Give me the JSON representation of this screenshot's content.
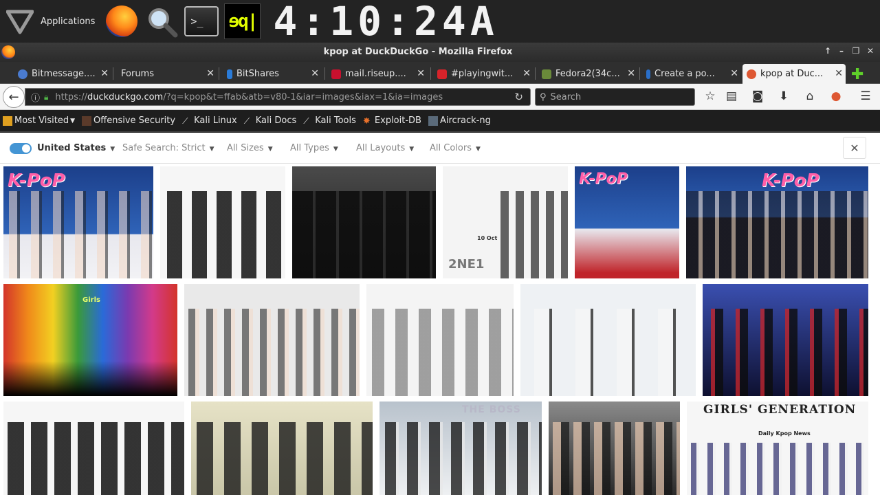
{
  "panel": {
    "applications_label": "Applications",
    "terminal_glyph": ">_",
    "cpu_graph_glyph": "ɘq|",
    "clock": "4:10:24A"
  },
  "window": {
    "title": "kpop at DuckDuckGo - Mozilla Firefox",
    "controls": [
      "↑",
      "–",
      "❐",
      "✕"
    ]
  },
  "tabs": [
    {
      "label": "Bitmessage....",
      "icon_color": "#4a7bd0",
      "active": false
    },
    {
      "label": "Forums",
      "icon_color": "",
      "active": false
    },
    {
      "label": "BitShares",
      "icon_color": "#2a7bd8",
      "active": false
    },
    {
      "label": "mail.riseup....",
      "icon_color": "#c8102e",
      "active": false
    },
    {
      "label": "#playingwit...",
      "icon_color": "#d8232a",
      "active": false
    },
    {
      "label": "Fedora2(34c...",
      "icon_color": "#6a8a3a",
      "active": false
    },
    {
      "label": "Create a po...",
      "icon_color": "#2a6fc9",
      "active": false
    },
    {
      "label": "kpop at Duc...",
      "icon_color": "#de5833",
      "active": true
    }
  ],
  "nav": {
    "url_prefix": "https://",
    "url_domain": "duckduckgo.com",
    "url_rest": "/?q=kpop&t=ffab&atb=v80-1&iar=images&iax=1&ia=images",
    "search_placeholder": "Search"
  },
  "bookmarks": [
    {
      "label": "Most Visited",
      "icon": "folder-icon",
      "dropdown": true
    },
    {
      "label": "Offensive Security",
      "icon": "offsec-icon"
    },
    {
      "label": "Kali Linux",
      "icon": "kali-dragon-icon"
    },
    {
      "label": "Kali Docs",
      "icon": "kali-dragon-icon"
    },
    {
      "label": "Kali Tools",
      "icon": "kali-dragon-icon"
    },
    {
      "label": "Exploit-DB",
      "icon": "exploitdb-icon"
    },
    {
      "label": "Aircrack-ng",
      "icon": "aircrack-icon"
    }
  ],
  "filters": {
    "region": "United States",
    "safe_search": "Safe Search: Strict",
    "sizes": "All Sizes",
    "types": "All Types",
    "layouts": "All Layouts",
    "colors": "All Colors"
  },
  "image_text": {
    "kpop_logo": "K-PoP",
    "girls_logo": "Girls",
    "calendar": "10 Oct",
    "ne1_logo": "2NE1",
    "the_boss": "THE BOSS",
    "girls_generation": "GIRLS' GENERATION",
    "daily_kpop": "Daily Kpop News"
  }
}
